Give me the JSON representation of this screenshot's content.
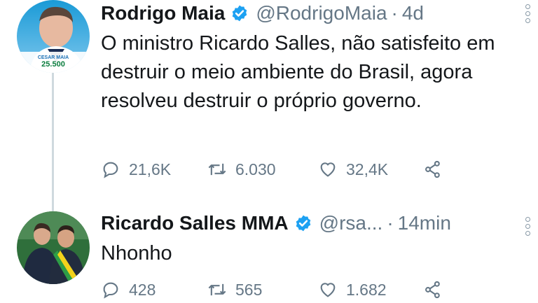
{
  "tweets": [
    {
      "author_name": "Rodrigo Maia",
      "handle": "@RodrigoMaia",
      "separator": "·",
      "time": "4d",
      "text": "O ministro Ricardo Salles, não satisfeito em destruir o meio ambiente do Brasil, agora resolveu destruir o próprio governo.",
      "avatar_caption": "CESAR MAIA 25.500",
      "replies": "21,6K",
      "retweets": "6.030",
      "likes": "32,4K"
    },
    {
      "author_name": "Ricardo Salles MMA",
      "handle": "@rsa...",
      "separator": "·",
      "time": "14min",
      "text": "Nhonho",
      "replies": "428",
      "retweets": "565",
      "likes": "1.682"
    }
  ],
  "colors": {
    "verified": "#1da1f2",
    "secondary_text": "#657786",
    "thread_line": "#cfd9de"
  }
}
